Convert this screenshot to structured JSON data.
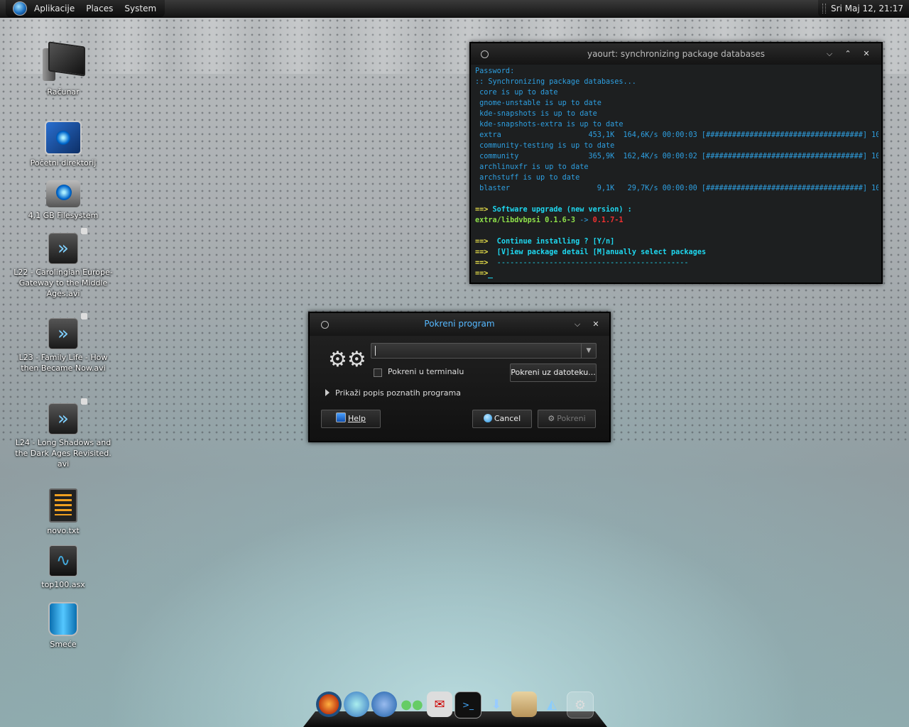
{
  "top_panel": {
    "menu": [
      "Aplikacije",
      "Places",
      "System"
    ],
    "clock": "Sri Maj 12, 21:17"
  },
  "desktop_icons": [
    {
      "label": "Računar",
      "icon": "computer-icon"
    },
    {
      "label": "Početni direktorij",
      "icon": "home-folder-icon"
    },
    {
      "label": "4,1 GB Filesystem",
      "icon": "drive-icon"
    },
    {
      "label": "L22 - Carolingian Europe- Gateway to the Middle Ages.avi",
      "icon": "video-file-icon"
    },
    {
      "label": "L23 - Family Life - How then Became Now.avi",
      "icon": "video-file-icon"
    },
    {
      "label": "L24 - Long Shadows and the Dark Ages Revisited. avi",
      "icon": "video-file-icon"
    },
    {
      "label": "novo.txt",
      "icon": "text-file-icon"
    },
    {
      "label": "top100.asx",
      "icon": "audio-playlist-icon"
    },
    {
      "label": "Smeće",
      "icon": "trash-icon"
    }
  ],
  "terminal": {
    "title": "yaourt: synchronizing package databases",
    "lines": {
      "l1": "Password:",
      "l2": ":: Synchronizing package databases...",
      "l3": " core is up to date",
      "l4": " gnome-unstable is up to date",
      "l5": " kde-snapshots is up to date",
      "l6": " kde-snapshots-extra is up to date",
      "l7": " extra                    453,1K  164,6K/s 00:00:03 [####################################] 100%",
      "l8": " community-testing is up to date",
      "l9": " community                365,9K  162,4K/s 00:00:02 [####################################] 100%",
      "l10": " archlinuxfr is up to date",
      "l11": " archstuff is up to date",
      "l12": " blaster                    9,1K   29,7K/s 00:00:00 [####################################] 100%",
      "l13_arrow": "==>",
      "l13_text": " Software upgrade (new version) :",
      "l14_pkg": "extra/libdvbpsi 0.1.6-3",
      "l14_sep": " -> ",
      "l14_new": "0.1.7-1",
      "l15_arrow": "==> ",
      "l15_text": " Continue installing ? [Y/n]",
      "l16_arrow": "==> ",
      "l16_text": " [V]iew package detail [M]anually select packages",
      "l17_arrow": "==> ",
      "l17_text": " --------------------------------------------",
      "l18_arrow": "==>",
      "l18_text": " "
    }
  },
  "run_dialog": {
    "title": "Pokreni program",
    "command_value": "",
    "run_in_terminal_label": "Pokreni u terminalu",
    "run_with_file_button": "Pokreni uz datoteku...",
    "show_known_programs": "Prikaži popis poznatih programa",
    "help_button": "Help",
    "cancel_button": "Cancel",
    "run_button": "Pokreni"
  },
  "dock_icons": [
    "firefox-icon",
    "pidgin-icon",
    "web-browser-icon",
    "contacts-icon",
    "mail-icon",
    "terminal-icon",
    "software-update-icon",
    "documents-icon",
    "network-icon",
    "settings-icon"
  ]
}
